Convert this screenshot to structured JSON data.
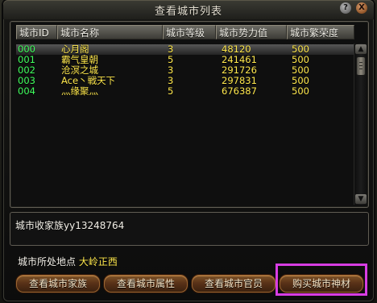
{
  "window": {
    "title": "查看城市列表",
    "help_glyph": "?",
    "close_glyph": "X"
  },
  "columns": [
    "城市ID",
    "城市名称",
    "城市等级",
    "城市势力值",
    "城市繁荣度"
  ],
  "rows": [
    {
      "id": "000",
      "name": "心月阁",
      "level": "3",
      "power": "48120",
      "prosperity": "500",
      "selected": true
    },
    {
      "id": "001",
      "name": "霸气皇朝",
      "level": "5",
      "power": "241461",
      "prosperity": "500"
    },
    {
      "id": "002",
      "name": "沧溟之城",
      "level": "3",
      "power": "291726",
      "prosperity": "500"
    },
    {
      "id": "003",
      "name": "Ace丶戦天下",
      "level": "3",
      "power": "297831",
      "prosperity": "500"
    },
    {
      "id": "004",
      "name": "灬缘聚灬",
      "level": "5",
      "power": "676387",
      "prosperity": "500"
    }
  ],
  "family": {
    "text": "城市收家族yy13248764"
  },
  "location": {
    "label": "城市所处地点",
    "value": "大岭正西"
  },
  "buttons": {
    "family": "查看城市家族",
    "attributes": "查看城市属性",
    "officials": "查看城市官员",
    "materials": "购买城市神材"
  },
  "colors": {
    "id_text": "#40ff5e",
    "value_text": "#ffe84d",
    "highlight_border": "#d73de3"
  }
}
